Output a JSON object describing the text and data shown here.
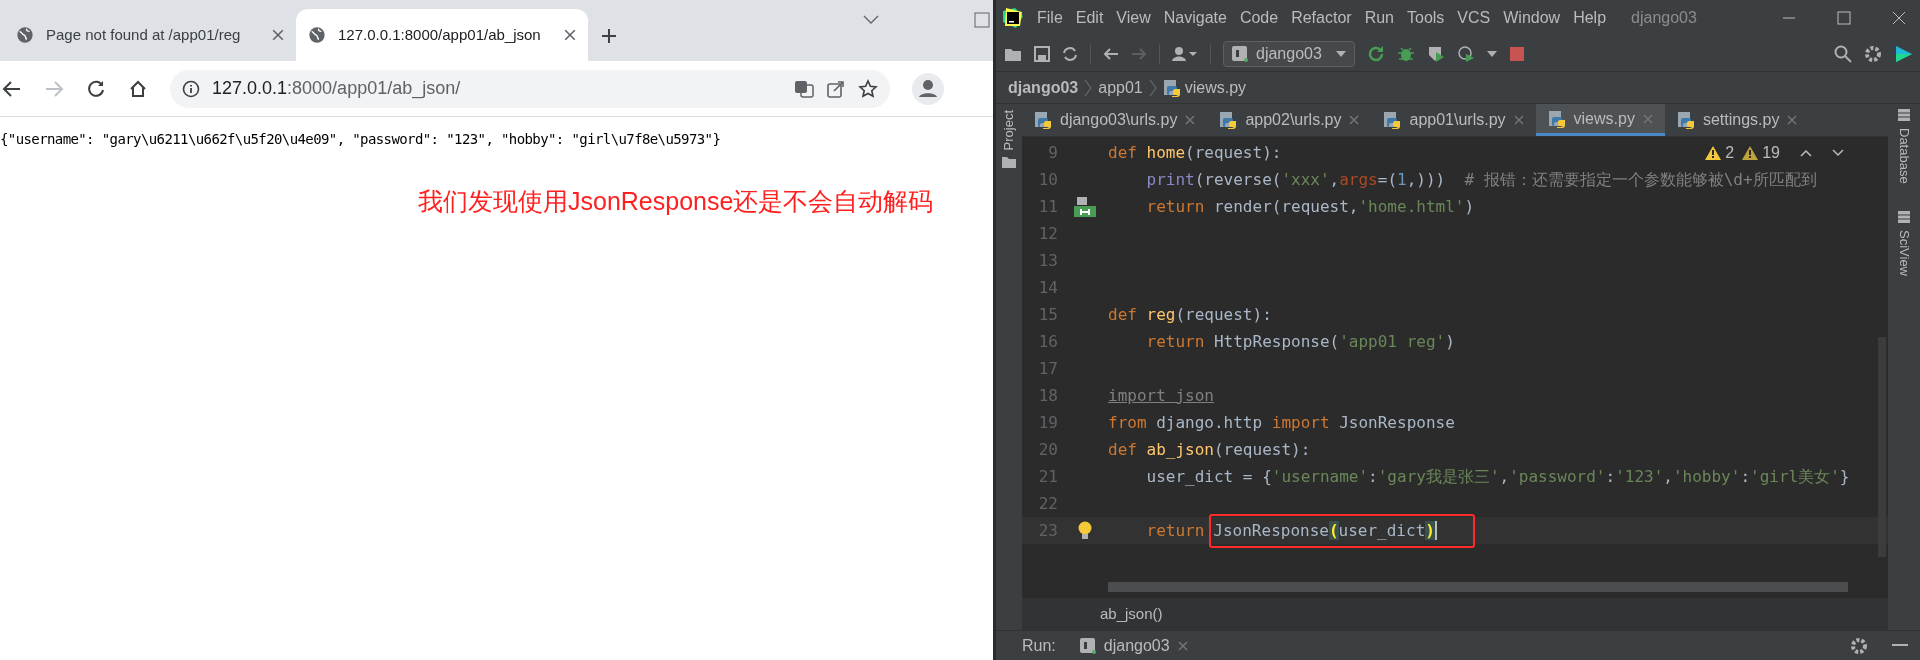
{
  "browser": {
    "tabs": [
      {
        "title": "Page not found at /app01/reg",
        "selected": false
      },
      {
        "title": "127.0.0.1:8000/app01/ab_json",
        "selected": true
      }
    ],
    "address": {
      "host": "127.0.0.1",
      "path": ":8000/app01/ab_json/"
    },
    "body_text": "{\"username\": \"gary\\u6211\\u662f\\u5f20\\u4e09\", \"password\": \"123\", \"hobby\": \"girl\\u7f8e\\u5973\"}",
    "annotation": "我们发现使用JsonResponse还是不会自动解码"
  },
  "ide": {
    "menu": [
      "File",
      "Edit",
      "View",
      "Navigate",
      "Code",
      "Refactor",
      "Run",
      "Tools",
      "VCS",
      "Window",
      "Help"
    ],
    "title": "django03",
    "run_config": "django03",
    "breadcrumb": [
      "django03",
      "app01",
      "views.py"
    ],
    "tabs": [
      {
        "label": "django03\\urls.py",
        "selected": false
      },
      {
        "label": "app02\\urls.py",
        "selected": false
      },
      {
        "label": "app01\\urls.py",
        "selected": false
      },
      {
        "label": "views.py",
        "selected": true
      },
      {
        "label": "settings.py",
        "selected": false
      }
    ],
    "left_tools": [
      "Project"
    ],
    "right_tools": [
      "Database",
      "SciView"
    ],
    "inspections": [
      {
        "kind": "warning",
        "count": "2"
      },
      {
        "kind": "weak",
        "count": "19"
      }
    ],
    "lines": [
      {
        "number": "9",
        "tokens": [
          {
            "kind": "kw",
            "t": "def "
          },
          {
            "kind": "fn",
            "t": "home"
          },
          {
            "kind": "plain",
            "t": "(request):"
          }
        ]
      },
      {
        "number": "10",
        "tokens": [
          {
            "kind": "builtin",
            "t": "    print"
          },
          {
            "kind": "plain",
            "t": "(reverse("
          },
          {
            "kind": "str",
            "t": "'xxx'"
          },
          {
            "kind": "plain",
            "t": ","
          },
          {
            "kind": "param",
            "t": "args"
          },
          {
            "kind": "plain",
            "t": "=("
          },
          {
            "kind": "num",
            "t": "1"
          },
          {
            "kind": "plain",
            "t": ",)))  "
          },
          {
            "kind": "comment",
            "t": "# 报错：还需要指定一个参数能够被\\d+所匹配到"
          }
        ]
      },
      {
        "number": "11",
        "gutter_icon": {
          "kind": "template"
        },
        "tokens": [
          {
            "kind": "kw",
            "t": "    return "
          },
          {
            "kind": "plain",
            "t": "render(request,"
          },
          {
            "kind": "str",
            "t": "'home.html'"
          },
          {
            "kind": "plain",
            "t": ")"
          }
        ]
      },
      {
        "number": "12"
      },
      {
        "number": "13"
      },
      {
        "number": "14"
      },
      {
        "number": "15",
        "tokens": [
          {
            "kind": "kw",
            "t": "def "
          },
          {
            "kind": "fn",
            "t": "reg"
          },
          {
            "kind": "plain",
            "t": "(request):"
          }
        ]
      },
      {
        "number": "16",
        "tokens": [
          {
            "kind": "kw",
            "t": "    return "
          },
          {
            "kind": "plain",
            "t": "HttpResponse("
          },
          {
            "kind": "str",
            "t": "'app01 reg'"
          },
          {
            "kind": "plain",
            "t": ")"
          }
        ]
      },
      {
        "number": "17"
      },
      {
        "number": "18",
        "tokens": [
          {
            "kind": "unused",
            "t": "import json"
          }
        ]
      },
      {
        "number": "19",
        "tokens": [
          {
            "kind": "kw",
            "t": "from "
          },
          {
            "kind": "plain",
            "t": "django.http "
          },
          {
            "kind": "kw",
            "t": "import "
          },
          {
            "kind": "plain",
            "t": "JsonResponse"
          }
        ]
      },
      {
        "number": "20",
        "tokens": [
          {
            "kind": "kw",
            "t": "def "
          },
          {
            "kind": "fn",
            "t": "ab_json"
          },
          {
            "kind": "plain",
            "t": "(request):"
          }
        ]
      },
      {
        "number": "21",
        "tokens": [
          {
            "kind": "plain",
            "t": "    user_dict = {"
          },
          {
            "kind": "str",
            "t": "'username'"
          },
          {
            "kind": "plain",
            "t": ":"
          },
          {
            "kind": "str",
            "t": "'gary我是张三'"
          },
          {
            "kind": "plain",
            "t": ","
          },
          {
            "kind": "str",
            "t": "'password'"
          },
          {
            "kind": "plain",
            "t": ":"
          },
          {
            "kind": "str",
            "t": "'123'"
          },
          {
            "kind": "plain",
            "t": ","
          },
          {
            "kind": "str",
            "t": "'hobby'"
          },
          {
            "kind": "plain",
            "t": ":"
          },
          {
            "kind": "str",
            "t": "'girl美女'"
          },
          {
            "kind": "plain",
            "t": "}"
          }
        ]
      },
      {
        "number": "22"
      },
      {
        "number": "23",
        "gutter_icon": {
          "kind": "bulb"
        },
        "current": true,
        "tokens": [
          {
            "kind": "kw",
            "t": "    return"
          },
          {
            "kind": "plain",
            "t": "JsonResponse",
            "framed": true
          },
          {
            "kind": "brace",
            "t": "(",
            "framed": true
          },
          {
            "kind": "plain",
            "t": "user_dict",
            "framed": true
          },
          {
            "kind": "brace",
            "t": ")",
            "framed": true
          }
        ]
      }
    ],
    "footer_breadcrumb": "ab_json()",
    "run": {
      "label": "Run:",
      "tab": "django03"
    }
  }
}
